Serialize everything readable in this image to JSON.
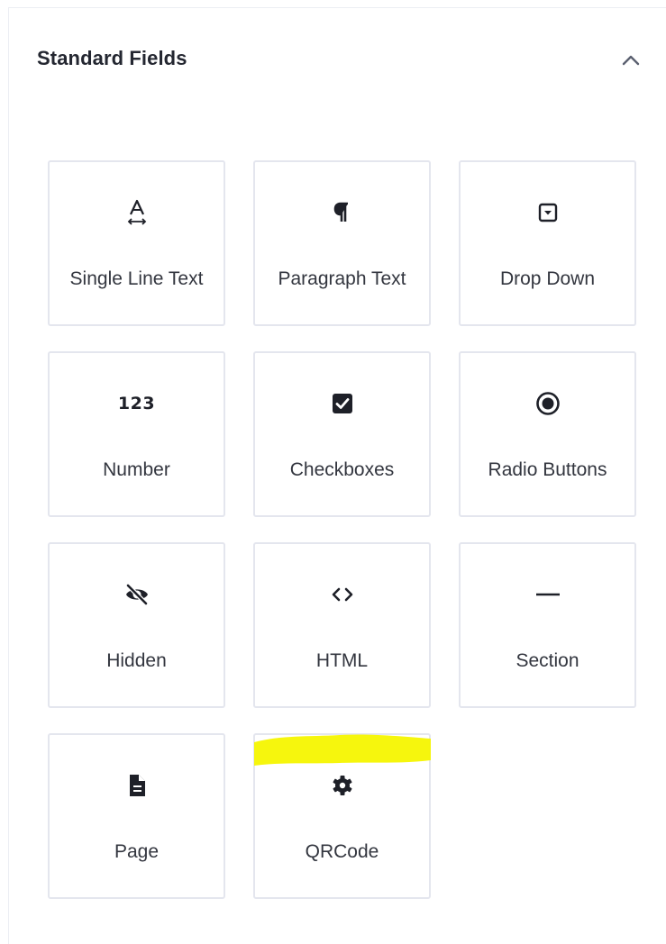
{
  "panel": {
    "title": "Standard Fields",
    "collapse_icon": "chevron-up-icon"
  },
  "fields": [
    {
      "label": "Single Line Text",
      "icon": "text-a-icon"
    },
    {
      "label": "Paragraph Text",
      "icon": "pilcrow-icon"
    },
    {
      "label": "Drop Down",
      "icon": "dropdown-icon"
    },
    {
      "label": "Number",
      "icon": "number-123-icon",
      "glyph": "123"
    },
    {
      "label": "Checkboxes",
      "icon": "checkbox-icon"
    },
    {
      "label": "Radio Buttons",
      "icon": "radio-icon"
    },
    {
      "label": "Hidden",
      "icon": "eye-slash-icon"
    },
    {
      "label": "HTML",
      "icon": "code-icon"
    },
    {
      "label": "Section",
      "icon": "minus-icon"
    },
    {
      "label": "Page",
      "icon": "document-icon"
    },
    {
      "label": "QRCode",
      "icon": "gear-icon"
    }
  ],
  "colors": {
    "border": "#e4e6ee",
    "icon": "#1e2028",
    "highlight": "#f5f500"
  }
}
